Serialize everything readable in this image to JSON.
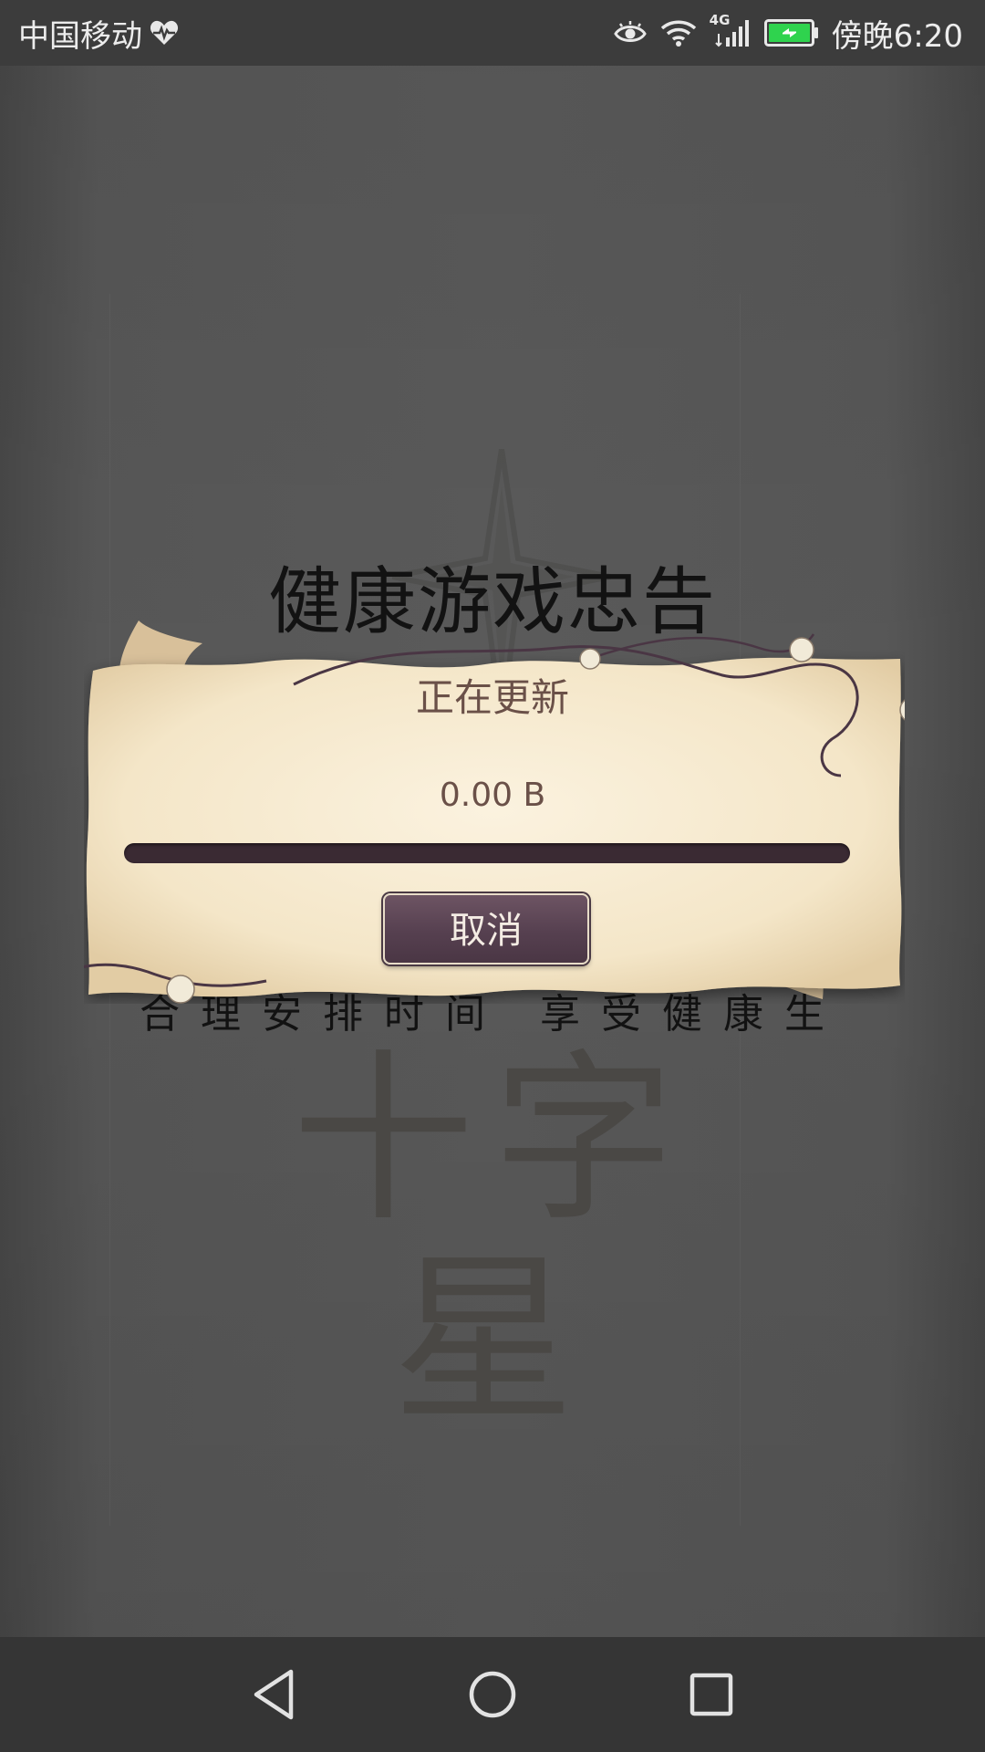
{
  "status_bar": {
    "carrier": "中国移动",
    "network_type": "4G",
    "battery_color": "#2fd34e",
    "time": "傍晚6:20"
  },
  "background": {
    "health_title": "健康游戏忠告",
    "health_subtitle": "合理安排时间 享受健康生",
    "logo_text": "十字星"
  },
  "dialog": {
    "title": "正在更新",
    "size_text": "0.00 B",
    "progress": 0,
    "cancel_label": "取消"
  },
  "nav_bar": {
    "icons": [
      "back-icon",
      "home-icon",
      "recent-apps-icon"
    ]
  }
}
